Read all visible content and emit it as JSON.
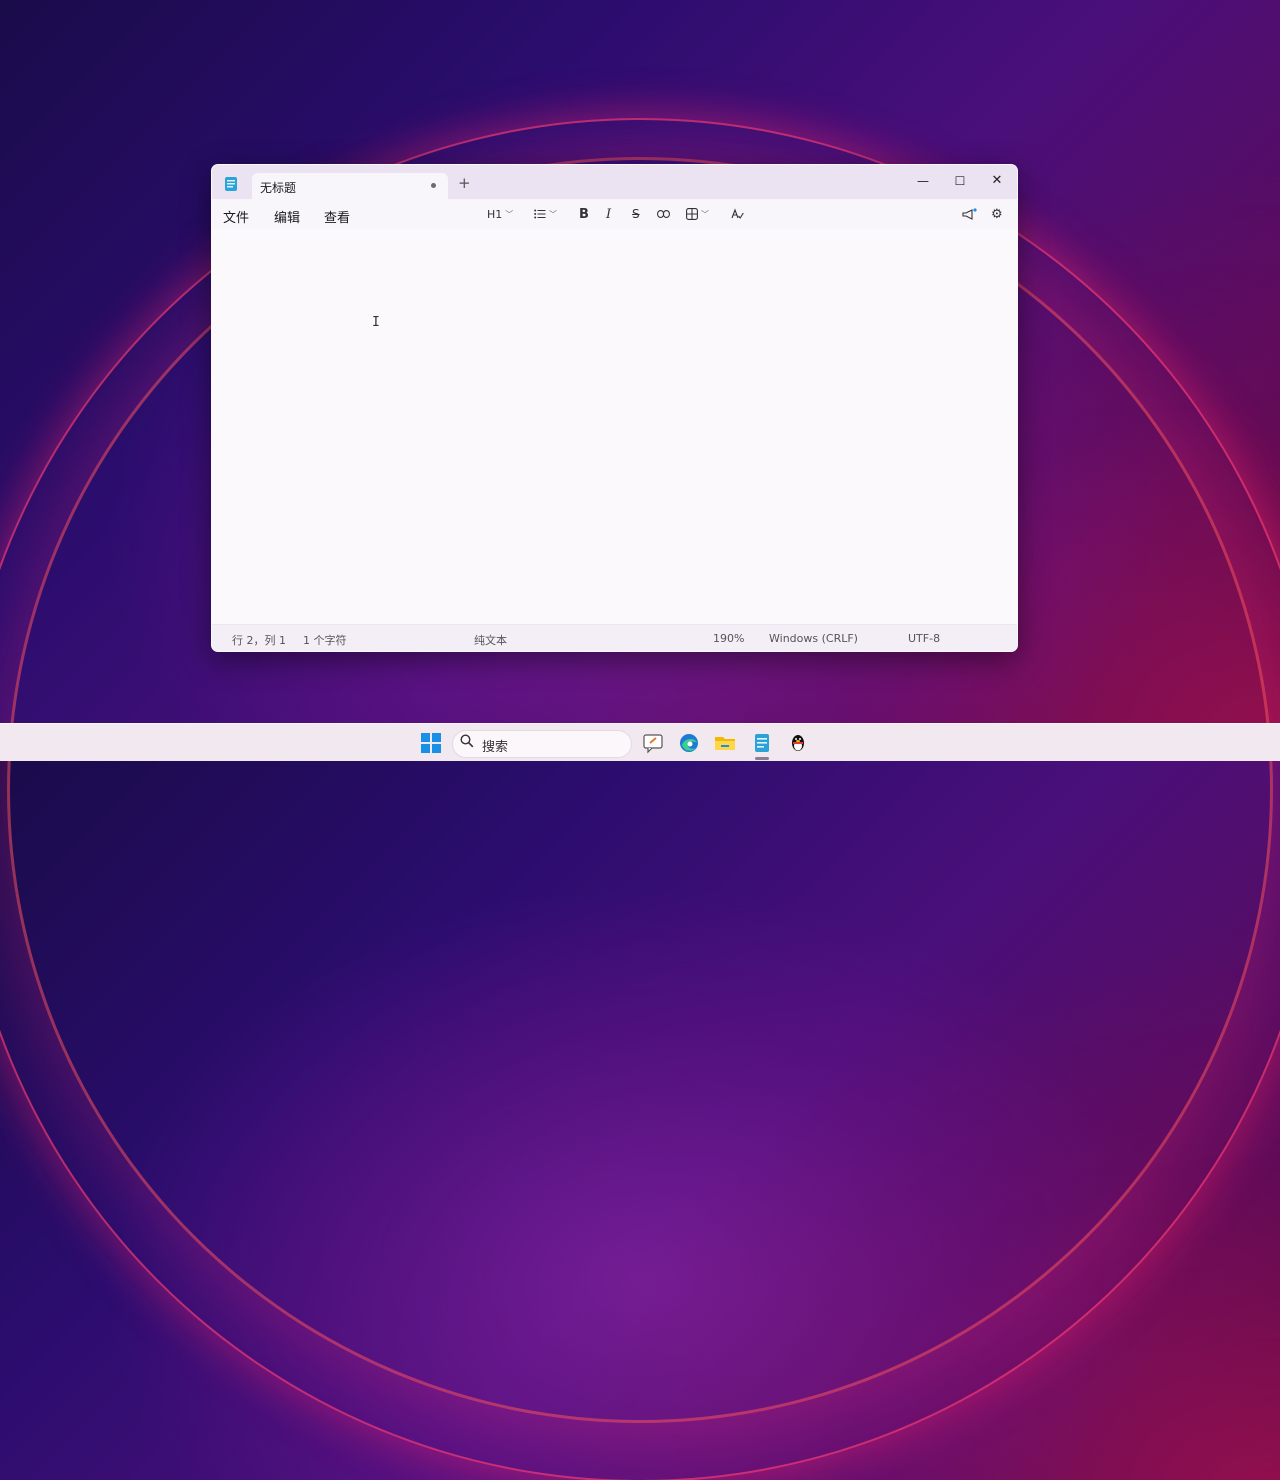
{
  "window": {
    "tab_title": "无标题",
    "new_tab": "+",
    "controls": {
      "minimize": "—",
      "maximize": "☐",
      "close": "✕"
    }
  },
  "menu": {
    "file": "文件",
    "edit": "编辑",
    "view": "查看"
  },
  "toolbar": {
    "heading": "H1",
    "bold": "B",
    "italic": "I",
    "strike": "S",
    "chevron": "﹀"
  },
  "editor": {
    "cursor_glyph": "I"
  },
  "status": {
    "position": "行 2，列 1",
    "chars": "1 个字符",
    "format": "纯文本",
    "zoom": "190%",
    "line_ending": "Windows (CRLF)",
    "encoding": "UTF-8"
  },
  "taskbar": {
    "search_placeholder": "搜索",
    "apps": [
      "chat-icon",
      "edge-icon",
      "file-explorer-icon",
      "notepad-icon",
      "qq-icon"
    ]
  },
  "colors": {
    "accent": "#1a8fe6",
    "window_bg": "#f9f6fb",
    "titlebar_bg": "#ece3f2"
  }
}
